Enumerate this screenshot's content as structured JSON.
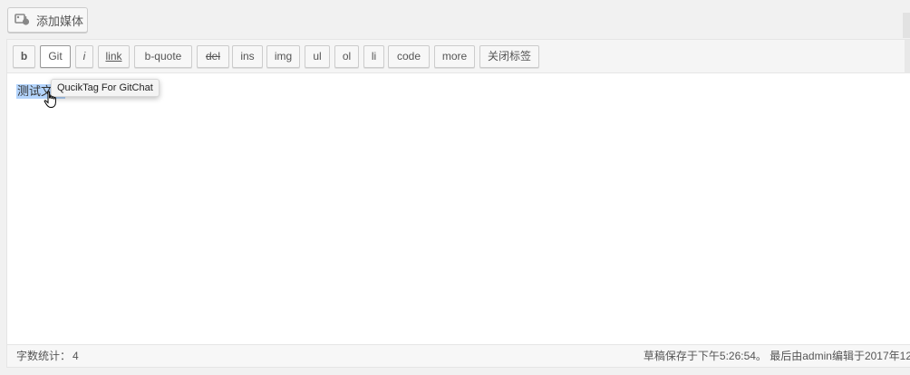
{
  "media": {
    "add_media_label": "添加媒体",
    "icon": "media-library-icon"
  },
  "toolbar": {
    "buttons": [
      {
        "label": "b"
      },
      {
        "label": "Git"
      },
      {
        "label": "i"
      },
      {
        "label": "link"
      },
      {
        "label": "b-quote"
      },
      {
        "label": "del"
      },
      {
        "label": "ins"
      },
      {
        "label": "img"
      },
      {
        "label": "ul"
      },
      {
        "label": "ol"
      },
      {
        "label": "li"
      },
      {
        "label": "code"
      },
      {
        "label": "more"
      },
      {
        "label": "关闭标签"
      }
    ]
  },
  "editor": {
    "content": "测试文字",
    "tooltip": "QucikTag For GitChat"
  },
  "status": {
    "word_count_label": "字数统计：",
    "word_count_value": "4",
    "save_status": "草稿保存于下午5:26:54。 最后由admin编辑于2017年12"
  },
  "colors": {
    "selection": "#b3d4fc",
    "border": "#cccccc",
    "toolbar_bg": "#f5f5f5"
  }
}
